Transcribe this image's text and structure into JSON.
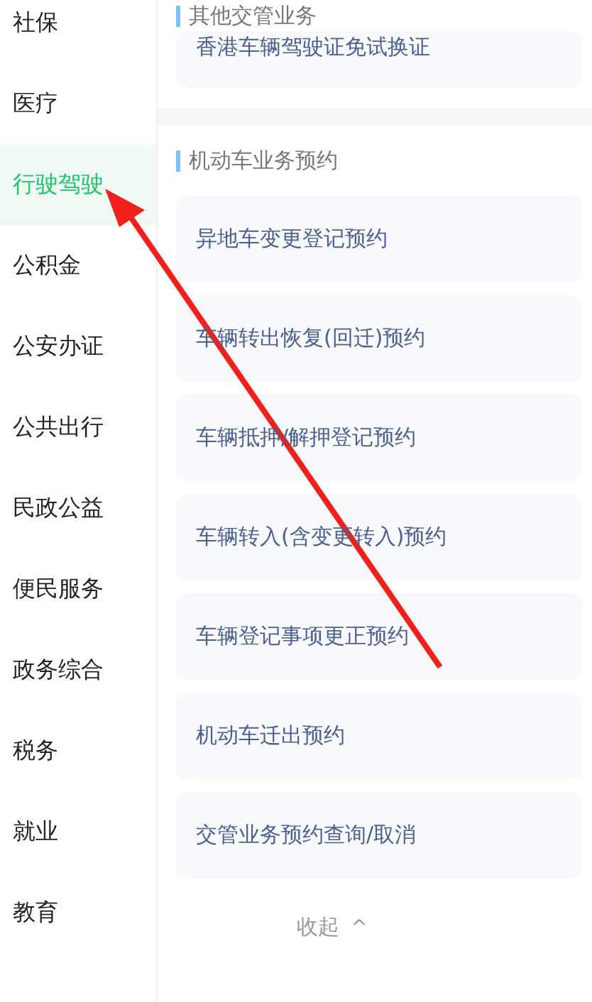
{
  "sidebar": {
    "items": [
      {
        "label": "社保",
        "selected": false
      },
      {
        "label": "医疗",
        "selected": false
      },
      {
        "label": "行驶驾驶",
        "selected": true
      },
      {
        "label": "公积金",
        "selected": false
      },
      {
        "label": "公安办证",
        "selected": false
      },
      {
        "label": "公共出行",
        "selected": false
      },
      {
        "label": "民政公益",
        "selected": false
      },
      {
        "label": "便民服务",
        "selected": false
      },
      {
        "label": "政务综合",
        "selected": false
      },
      {
        "label": "税务",
        "selected": false
      },
      {
        "label": "就业",
        "selected": false
      },
      {
        "label": "教育",
        "selected": false
      }
    ]
  },
  "sections": [
    {
      "title": "其他交管业务",
      "items": [
        "香港车辆驾驶证免试换证"
      ]
    },
    {
      "title": "机动车业务预约",
      "items": [
        "异地车变更登记预约",
        "车辆转出恢复(回迁)预约",
        "车辆抵押/解押登记预约",
        "车辆转入(含变更转入)预约",
        "车辆登记事项更正预约",
        "机动车迁出预约",
        "交管业务预约查询/取消"
      ]
    }
  ],
  "collapse": {
    "label": "收起",
    "icon": "^"
  }
}
